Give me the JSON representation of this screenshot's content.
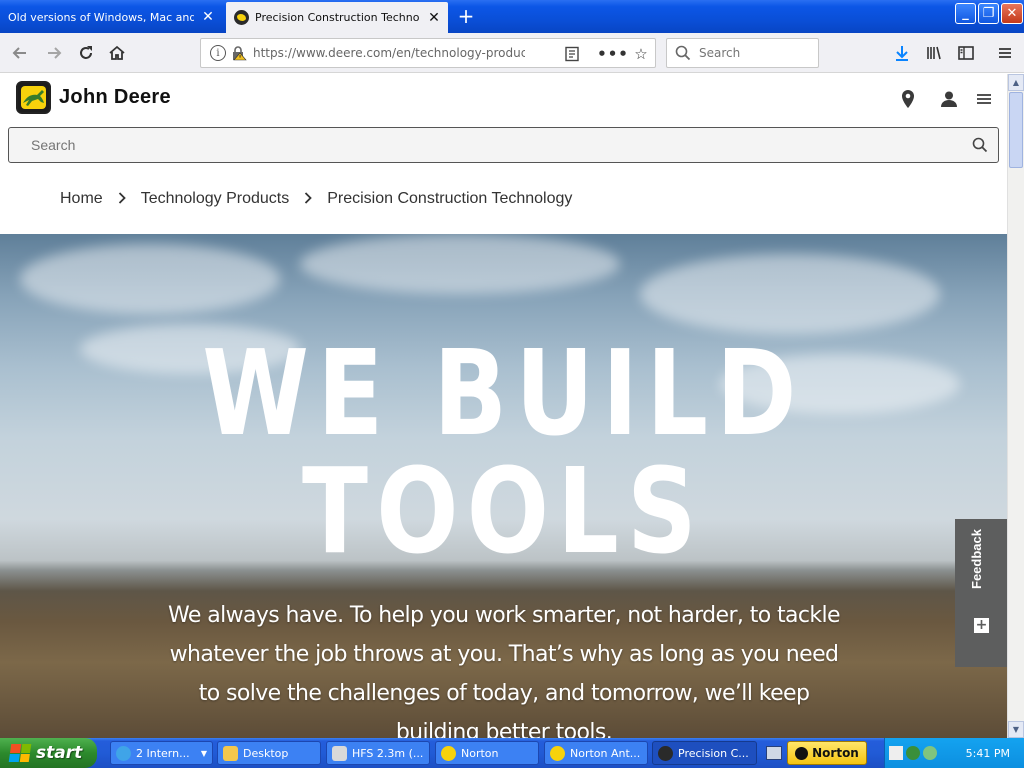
{
  "browser": {
    "tabs": [
      {
        "title": "Old versions of Windows, Mac and Linu",
        "active": false
      },
      {
        "title": "Precision Construction Technology",
        "active": true
      }
    ],
    "url": "https://www.deere.com/en/technology-product",
    "url_domain": "deere.com",
    "search_placeholder": "Search"
  },
  "site": {
    "brand": "John Deere",
    "search_placeholder": "Search",
    "breadcrumbs": [
      "Home",
      "Technology Products",
      "Precision Construction Technology"
    ]
  },
  "hero": {
    "title_line1": "WE BUILD",
    "title_line2": "TOOLS",
    "body": "We always have. To help you work smarter, not harder, to tackle whatever the job throws at you. That’s why as long as you need to solve the challenges of today, and tomorrow, we’ll keep building better tools."
  },
  "feedback": {
    "label": "Feedback"
  },
  "taskbar": {
    "start_label": "start",
    "items": [
      {
        "label": "2 Intern...",
        "icon_color": "#3fa4e8"
      },
      {
        "label": "Desktop",
        "icon_color": "#f3c74c"
      },
      {
        "label": "HFS 2.3m (...",
        "icon_color": "#d9d9d9"
      },
      {
        "label": "Norton",
        "icon_color": "#f7d20c"
      },
      {
        "label": "Norton Ant...",
        "icon_color": "#f7d20c"
      },
      {
        "label": "Precision C...",
        "icon_color": "#2a2a2a"
      }
    ],
    "norton_badge": "Norton",
    "clock": "5:41 PM"
  },
  "colors": {
    "xp_blue": "#0c56e6",
    "deere_green": "#367c2b",
    "deere_yellow": "#f7d20c",
    "feedback_bg": "#5d5e5e",
    "firefox_blue": "#0a84ff"
  }
}
